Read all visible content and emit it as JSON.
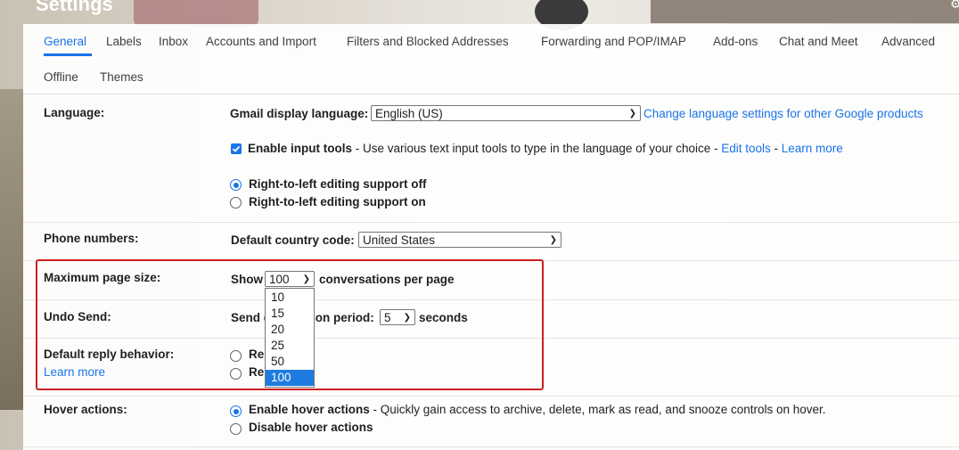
{
  "window": {
    "title": "Settings"
  },
  "tabs": [
    {
      "label": "General"
    },
    {
      "label": "Labels"
    },
    {
      "label": "Inbox"
    },
    {
      "label": "Accounts and Import"
    },
    {
      "label": "Filters and Blocked Addresses"
    },
    {
      "label": "Forwarding and POP/IMAP"
    },
    {
      "label": "Add-ons"
    },
    {
      "label": "Chat and Meet"
    },
    {
      "label": "Advanced"
    },
    {
      "label": "Offline"
    },
    {
      "label": "Themes"
    }
  ],
  "language": {
    "label": "Language:",
    "display_label": "Gmail display language:",
    "display_value": "English (US)",
    "change_link": "Change language settings for other Google products",
    "input_tools_label": "Enable input tools",
    "input_tools_desc": " - Use various text input tools to type in the language of your choice - ",
    "edit_tools": "Edit tools",
    "sep": " - ",
    "learn_more": "Learn more",
    "rtl_off": "Right-to-left editing support off",
    "rtl_on": "Right-to-left editing support on"
  },
  "phone": {
    "label": "Phone numbers:",
    "country_label": "Default country code:",
    "country_value": "United States"
  },
  "page_size": {
    "label": "Maximum page size:",
    "show": "Show",
    "value": "100",
    "suffix": "conversations per page",
    "options": [
      "10",
      "15",
      "20",
      "25",
      "50",
      "100"
    ]
  },
  "undo": {
    "label": "Undo Send:",
    "prefix_a": "Send c",
    "prefix_b": "ion period:",
    "value": "5",
    "suffix": "seconds"
  },
  "reply": {
    "label": "Default reply behavior:",
    "learn_more": "Learn more",
    "opt1": "Re",
    "opt2": "Re"
  },
  "hover": {
    "label": "Hover actions:",
    "enable": "Enable hover actions",
    "enable_desc": " - Quickly gain access to archive, delete, mark as read, and snooze controls on hover.",
    "disable": "Disable hover actions"
  },
  "colors": {
    "accent": "#1a73e8",
    "highlight": "#cc1f1f",
    "selected_option": "#1e7be0"
  },
  "icons": {
    "settings": "gear-icon",
    "checkbox": "check-icon",
    "chevron": "chevron-down-icon"
  }
}
